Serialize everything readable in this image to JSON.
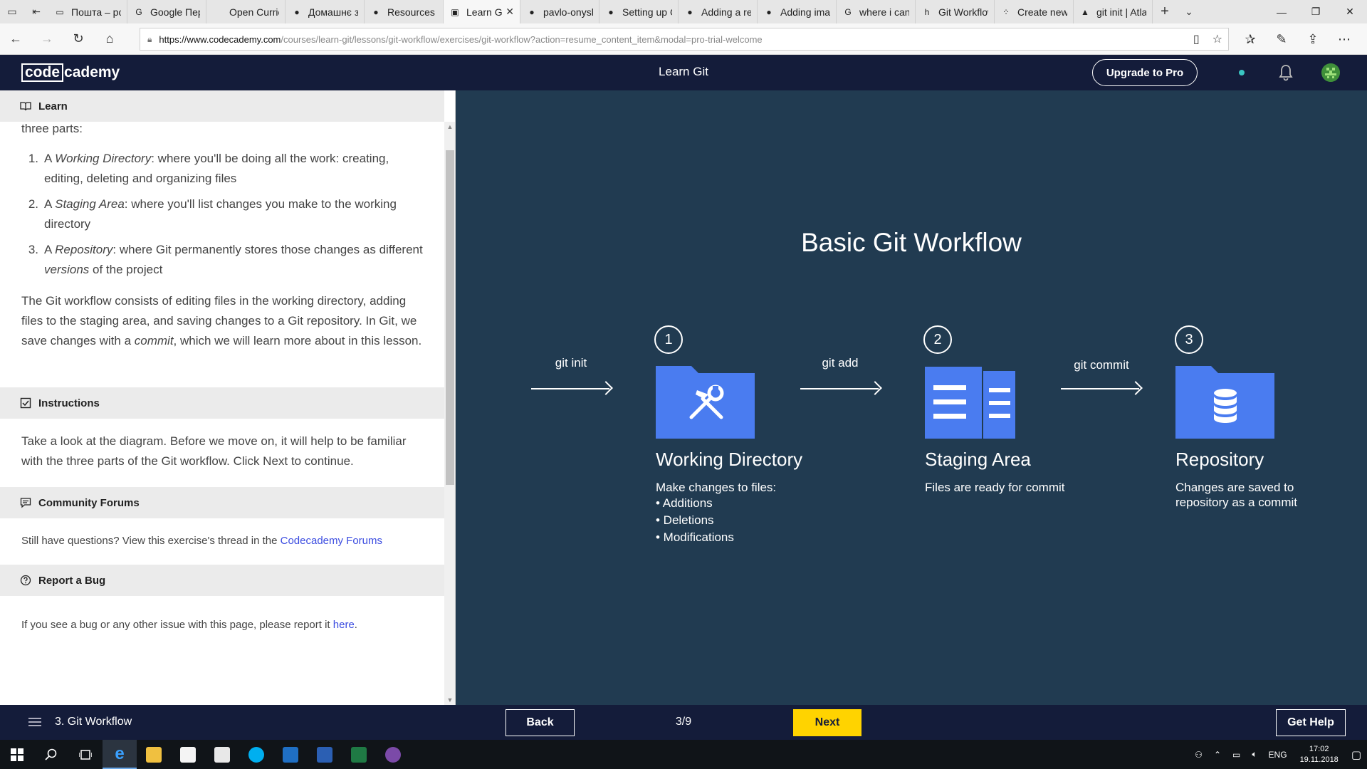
{
  "browser": {
    "tabs": [
      {
        "title": "Пошта – por",
        "icon": "mail-tab-icon"
      },
      {
        "title": "Google Пере",
        "icon": "google-translate-icon"
      },
      {
        "title": "Open Curricu",
        "icon": "blank-page-icon"
      },
      {
        "title": "Домашнє за",
        "icon": "github-icon"
      },
      {
        "title": "Resources to",
        "icon": "github-icon"
      },
      {
        "title": "Learn Gi",
        "icon": "codecademy-icon",
        "active": true
      },
      {
        "title": "pavlo-onysh",
        "icon": "github-icon"
      },
      {
        "title": "Setting up G",
        "icon": "github-icon"
      },
      {
        "title": "Adding a rep",
        "icon": "github-icon"
      },
      {
        "title": "Adding imag",
        "icon": "github-icon"
      },
      {
        "title": "where i can s",
        "icon": "google-icon"
      },
      {
        "title": "Git Workflow",
        "icon": "hashnode-icon"
      },
      {
        "title": "Create new g",
        "icon": "dots-icon"
      },
      {
        "title": "git init | Atla",
        "icon": "atlassian-icon"
      }
    ],
    "url_host": "https://www.codecademy.com",
    "url_path": "/courses/learn-git/lessons/git-workflow/exercises/git-workflow?action=resume_content_item&modal=pro-trial-welcome"
  },
  "header": {
    "logo_left": "code",
    "logo_right": "cademy",
    "title": "Learn Git",
    "upgrade_label": "Upgrade to Pro"
  },
  "learn": {
    "heading": "Learn",
    "intro": "three parts:",
    "list": [
      {
        "num": "1.",
        "pre": "A ",
        "em": "Working Directory",
        "post": ": where you'll be doing all the work: creating, editing, deleting and organizing files"
      },
      {
        "num": "2.",
        "pre": "A ",
        "em": "Staging Area",
        "post": ": where you'll list changes you make to the working directory"
      },
      {
        "num": "3.",
        "pre": "A ",
        "em": "Repository",
        "post": ": where Git permanently stores those changes as different ",
        "em2": "versions",
        "post2": " of the project"
      }
    ],
    "para_a": "The Git workflow consists of editing files in the working directory, adding files to the staging area, and saving changes to a Git repository. In Git, we save changes with a ",
    "para_em": "commit",
    "para_b": ", which we will learn more about in this lesson."
  },
  "instructions": {
    "heading": "Instructions",
    "text": "Take a look at the diagram. Before we move on, it will help to be familiar with the three parts of the Git workflow. Click Next to continue."
  },
  "forums": {
    "heading": "Community Forums",
    "text": "Still have questions? View this exercise's thread in the ",
    "link": "Codecademy Forums"
  },
  "bug": {
    "heading": "Report a Bug",
    "text": "If you see a bug or any other issue with this page, please report it ",
    "link": "here",
    "after": "."
  },
  "diagram": {
    "title": "Basic Git Workflow",
    "arrows": [
      "git init",
      "git add",
      "git commit"
    ],
    "stages": [
      {
        "num": "1",
        "name": "Working Directory",
        "desc": "Make changes to files:",
        "bullets": [
          "• Additions",
          "• Deletions",
          "• Modifications"
        ],
        "icon": "tools-folder-icon"
      },
      {
        "num": "2",
        "name": "Staging Area",
        "desc": "Files are ready for commit",
        "icon": "documents-icon"
      },
      {
        "num": "3",
        "name": "Repository",
        "desc_lines": [
          "Changes are saved to",
          "repository as a commit"
        ],
        "icon": "database-folder-icon"
      }
    ],
    "colors": {
      "background": "#213b51",
      "folder": "#4a7cf0",
      "folder_tab": "#3f6fe0"
    }
  },
  "footer": {
    "lesson": "3. Git Workflow",
    "back_label": "Back",
    "progress": "3/9",
    "next_label": "Next",
    "help_label": "Get Help",
    "colors": {
      "bar": "#141c3a",
      "next": "#ffd300"
    }
  },
  "taskbar": {
    "lang": "ENG",
    "time": "17:02",
    "date": "19.11.2018"
  }
}
